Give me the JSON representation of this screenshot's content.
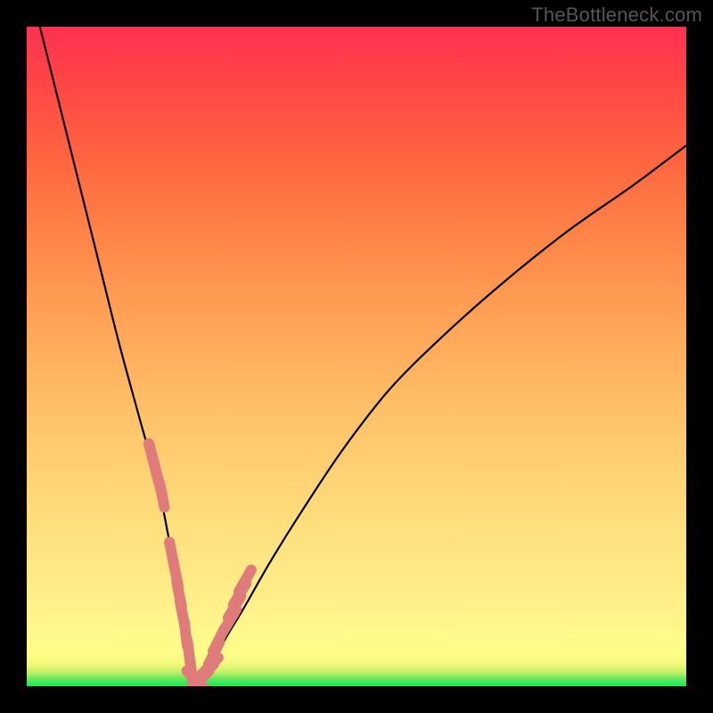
{
  "watermark": "TheBottleneck.com",
  "colors": {
    "frame": "#000000",
    "curve": "#000000",
    "marker": "#e07b7b",
    "gradient_top": "#ff3150",
    "gradient_mid": "#ffe582",
    "gradient_bottom": "#17e859"
  },
  "chart_data": {
    "type": "line",
    "title": "",
    "xlabel": "",
    "ylabel": "",
    "xlim": [
      0,
      100
    ],
    "ylim": [
      0,
      100
    ],
    "grid": false,
    "notes": "Bottleneck-percentage style curve. X is an unlabeled component-performance axis; Y is bottleneck % (0 = balanced, 100 = severe). Curve descends steeply from top-left, reaches ~0 near x≈25, then rises with diminishing slope toward the right. Markers cluster on both flanks of the valley and along its floor.",
    "series": [
      {
        "name": "bottleneck_curve",
        "x": [
          2,
          5,
          8,
          11,
          14,
          17,
          20,
          22,
          24,
          25,
          26,
          28,
          30,
          33,
          37,
          42,
          48,
          55,
          63,
          72,
          82,
          92,
          100
        ],
        "values": [
          100,
          88,
          76,
          64,
          52,
          41,
          30,
          20,
          10,
          2,
          1,
          3,
          7,
          12,
          19,
          27,
          36,
          45,
          53,
          61,
          69,
          76,
          82
        ]
      }
    ],
    "markers": {
      "name": "sample_points",
      "x": [
        19,
        19.5,
        20.0,
        20.5,
        22.0,
        22.6,
        23.1,
        23.6,
        24.1,
        24.6,
        25.0,
        25.6,
        26.3,
        27.0,
        27.7,
        28.4,
        29.1,
        30.8,
        31.5,
        32.3,
        33.1
      ],
      "values": [
        35,
        33,
        31,
        29,
        20,
        17,
        14,
        11,
        8,
        5,
        2,
        1,
        1,
        2,
        3,
        5,
        7,
        10,
        12,
        14,
        16
      ]
    }
  }
}
